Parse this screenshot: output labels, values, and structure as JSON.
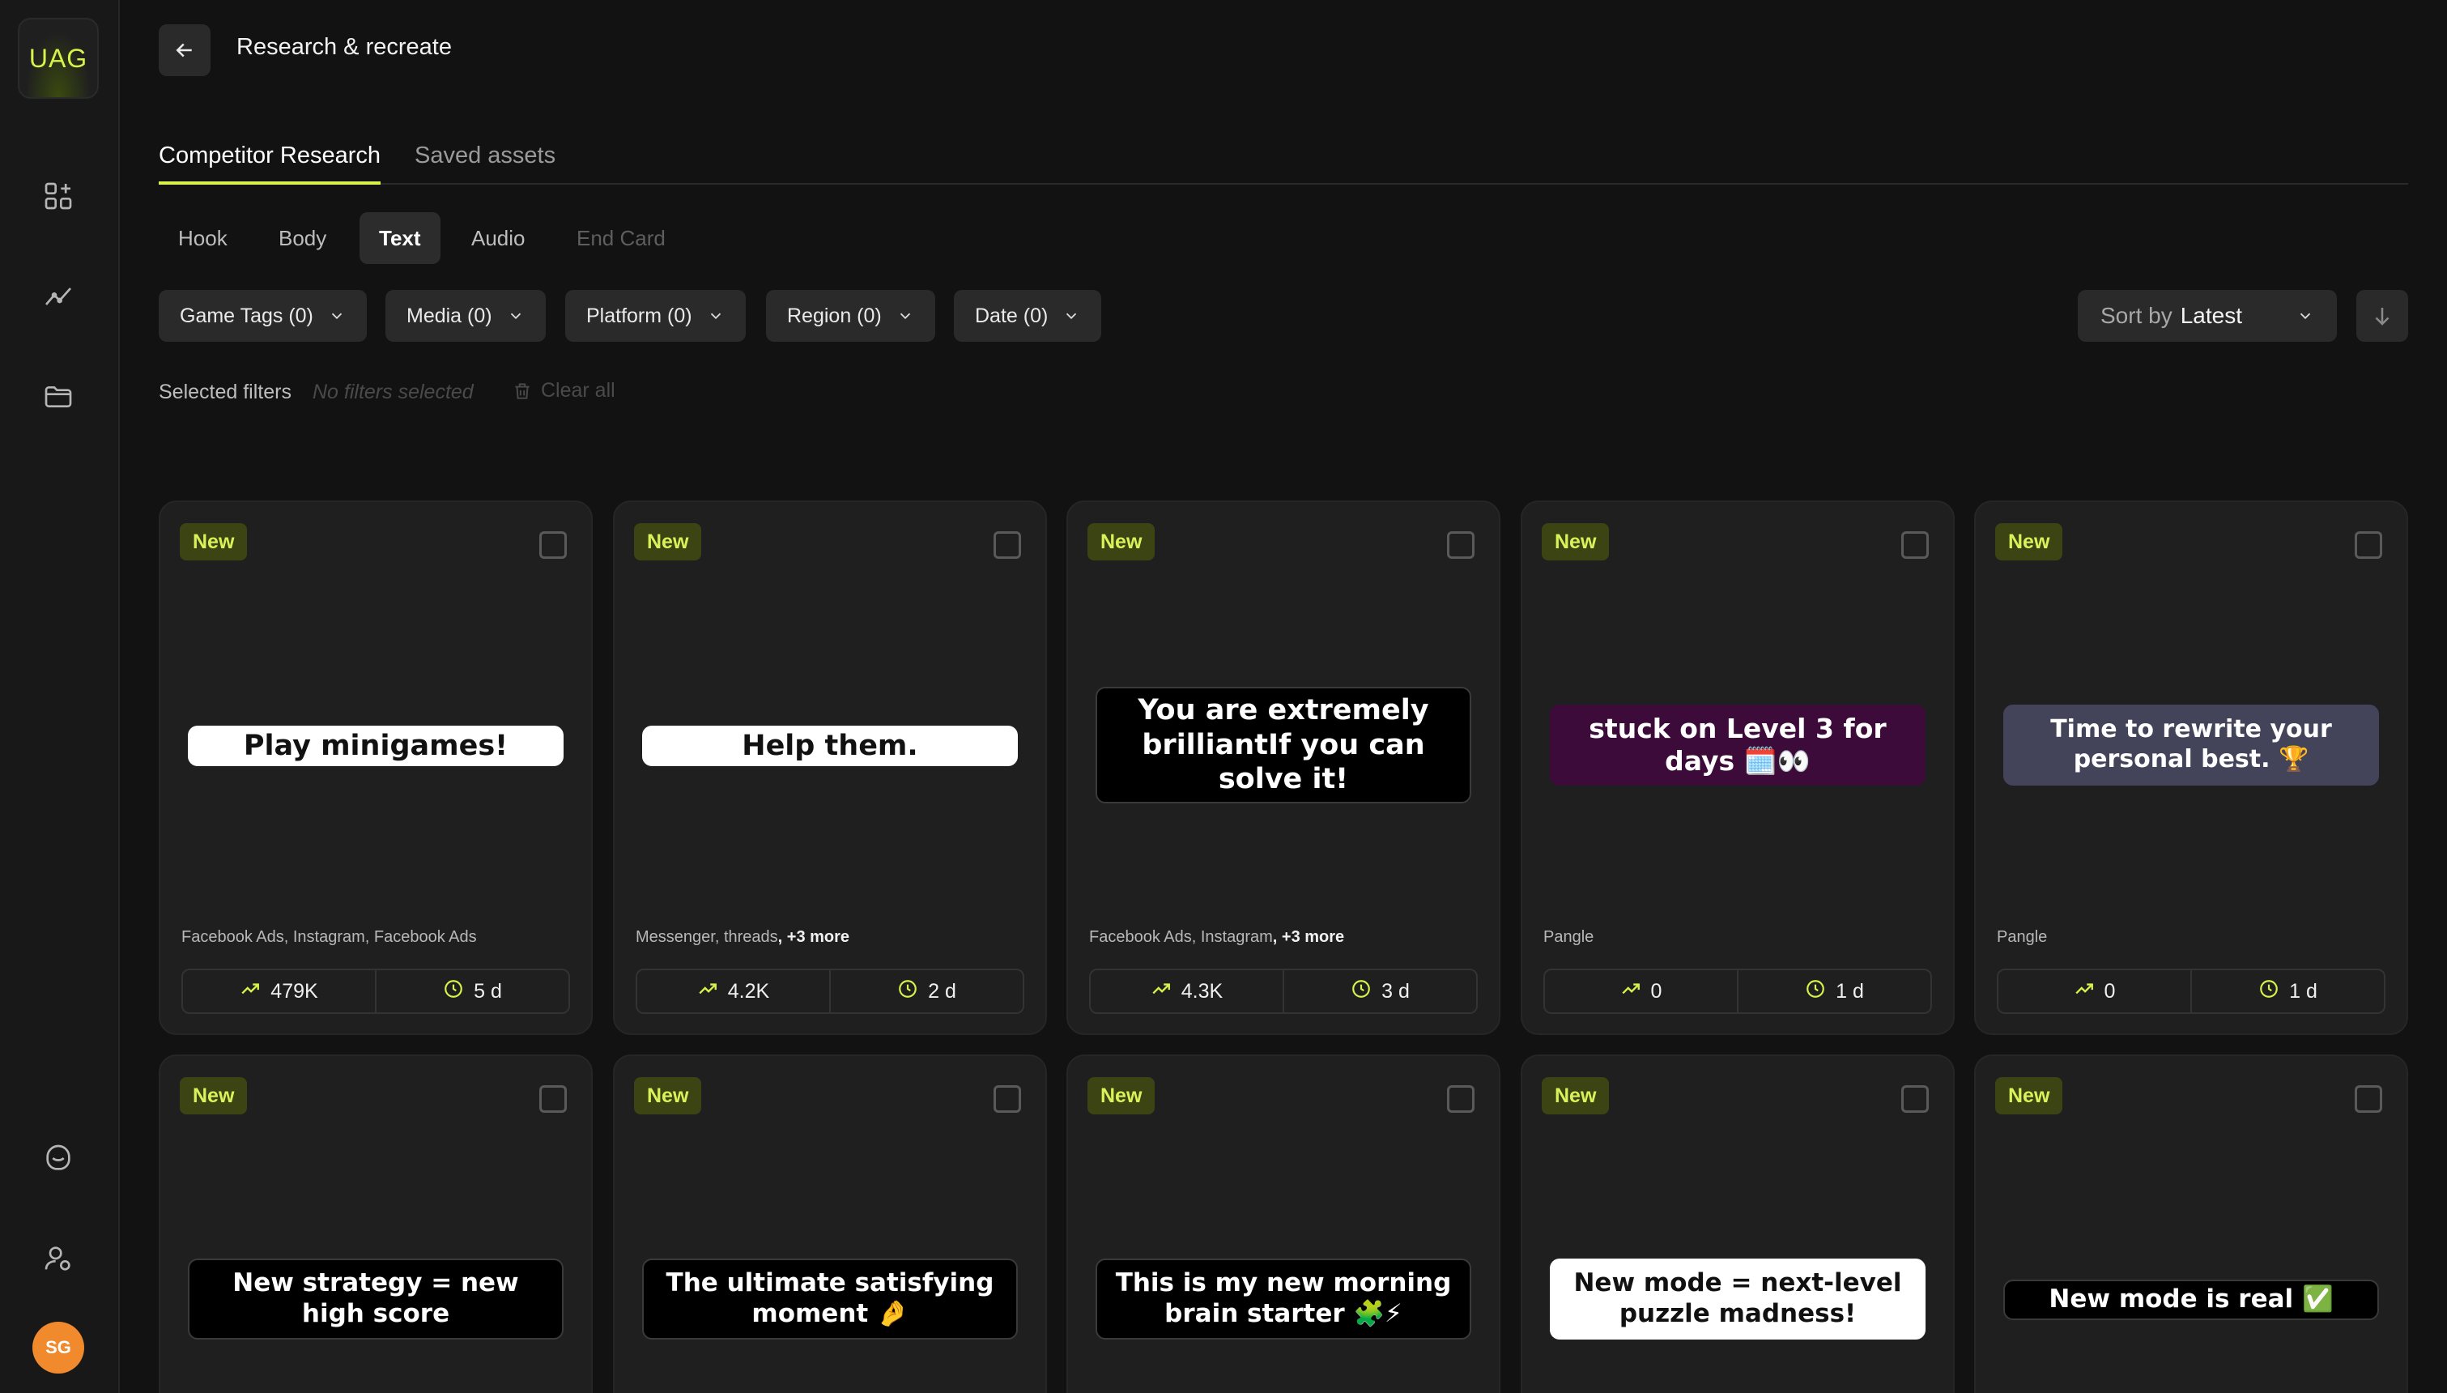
{
  "app": {
    "logo": "UAG",
    "user_initials": "SG"
  },
  "header": {
    "title": "Research & recreate"
  },
  "tabs": [
    {
      "label": "Competitor Research",
      "active": true
    },
    {
      "label": "Saved assets",
      "active": false
    }
  ],
  "subtabs": [
    {
      "label": "Hook"
    },
    {
      "label": "Body"
    },
    {
      "label": "Text",
      "active": true
    },
    {
      "label": "Audio"
    },
    {
      "label": "End Card",
      "disabled": true
    }
  ],
  "filters": [
    {
      "label": "Game Tags (0)"
    },
    {
      "label": "Media (0)"
    },
    {
      "label": "Platform (0)"
    },
    {
      "label": "Region (0)"
    },
    {
      "label": "Date (0)"
    }
  ],
  "sort": {
    "prefix": "Sort by",
    "value": "Latest"
  },
  "selected_filters": {
    "label": "Selected filters",
    "empty_text": "No filters selected",
    "clear_label": "Clear all"
  },
  "colors": {
    "accent": "#d7f34a",
    "badge_bg": "#3b4412",
    "card_bg": "#1f1f1f",
    "avatar": "#f08a2c"
  },
  "cards": [
    {
      "badge": "New",
      "caption": "Play minigames!",
      "style": "white",
      "platforms": "Facebook Ads, Instagram, Facebook Ads",
      "more": "",
      "reach": "479K",
      "age": "5 d"
    },
    {
      "badge": "New",
      "caption": "Help them.",
      "style": "white",
      "platforms": "Messenger, threads",
      "more": ", +3 more",
      "reach": "4.2K",
      "age": "2 d"
    },
    {
      "badge": "New",
      "caption": "You are extremely brilliantIf you can solve it!",
      "style": "black",
      "platforms": "Facebook Ads, Instagram",
      "more": ", +3 more",
      "reach": "4.3K",
      "age": "3 d"
    },
    {
      "badge": "New",
      "caption": "stuck on Level 3 for days 🗓️👀",
      "style": "purple",
      "platforms": "Pangle",
      "more": "",
      "reach": "0",
      "age": "1 d"
    },
    {
      "badge": "New",
      "caption": "Time to rewrite your personal best. 🏆",
      "style": "slate",
      "platforms": "Pangle",
      "more": "",
      "reach": "0",
      "age": "1 d"
    },
    {
      "badge": "New",
      "caption": "New strategy = new high score",
      "style": "black"
    },
    {
      "badge": "New",
      "caption": "The ultimate satisfying moment 🤌",
      "style": "black"
    },
    {
      "badge": "New",
      "caption": "This is my new morning brain starter 🧩⚡",
      "style": "black"
    },
    {
      "badge": "New",
      "caption": "New mode = next-level puzzle madness!",
      "style": "white"
    },
    {
      "badge": "New",
      "caption": "New mode is real ✅",
      "style": "black"
    }
  ]
}
